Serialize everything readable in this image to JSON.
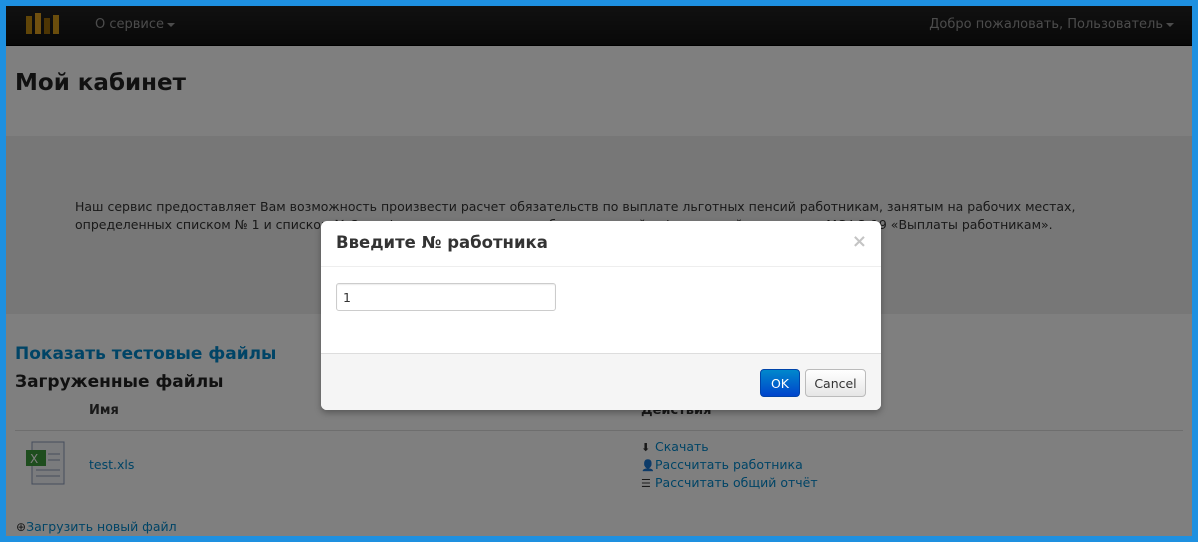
{
  "navbar": {
    "about_label": "О сервисе",
    "user_label": "Добро пожаловать, Пользователь"
  },
  "page": {
    "title": "Мой кабинет",
    "intro": "Наш сервис предоставляет Вам возможность произвести расчет обязательств по выплате льготных пенсий работникам, занятым на рабочих местах, определенных списком № 1 и списком № 2, и сформировать отчет для бухгалтерской и финансовой отчетности МСФО-19 «Выплаты работникам».",
    "show_test_files": "Показать тестовые файлы",
    "uploaded_files_title": "Загруженные файлы",
    "columns": {
      "name": "Имя",
      "actions": "Действия"
    },
    "files": [
      {
        "name": "test.xls",
        "actions": [
          "Скачать",
          "Рассчитать работника",
          "Рассчитать общий отчёт"
        ]
      }
    ],
    "upload_new": "Загрузить новый файл"
  },
  "modal": {
    "title": "Введите № работника",
    "close_symbol": "×",
    "input_value": "1",
    "ok_label": "OK",
    "cancel_label": "Cancel"
  }
}
